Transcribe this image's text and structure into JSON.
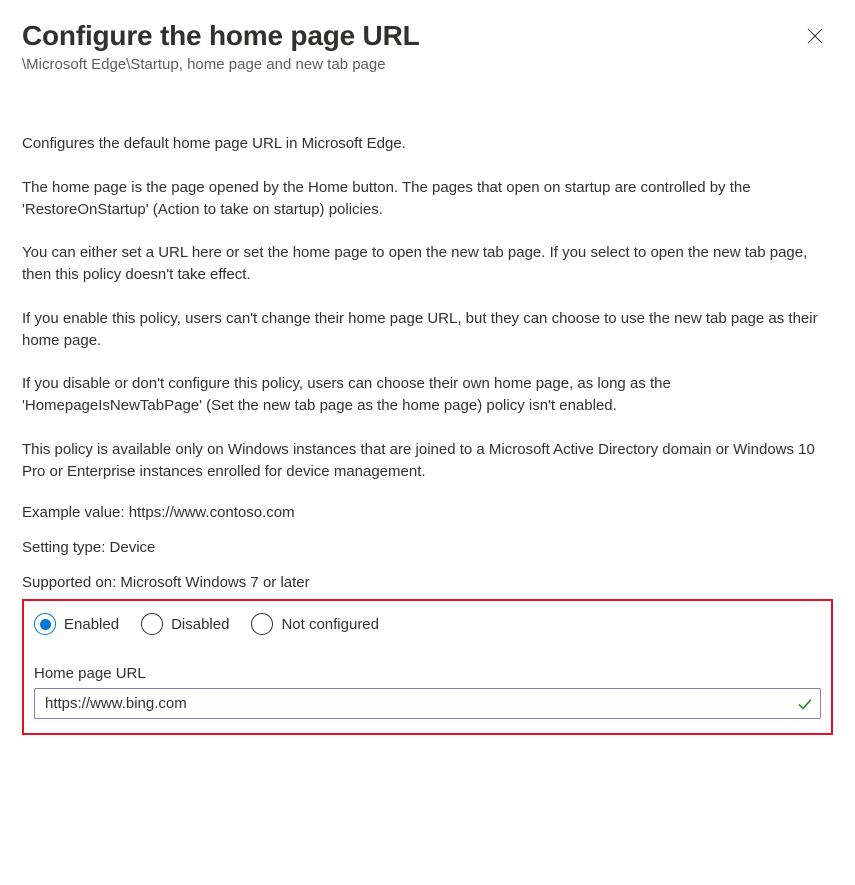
{
  "header": {
    "title": "Configure the home page URL",
    "breadcrumb": "\\Microsoft Edge\\Startup, home page and new tab page"
  },
  "description": {
    "p1": "Configures the default home page URL in Microsoft Edge.",
    "p2": "The home page is the page opened by the Home button. The pages that open on startup are controlled by the 'RestoreOnStartup' (Action to take on startup) policies.",
    "p3": "You can either set a URL here or set the home page to open the new tab page. If you select to open the new tab page, then this policy doesn't take effect.",
    "p4": "If you enable this policy, users can't change their home page URL, but they can choose to use the new tab page as their home page.",
    "p5": "If you disable or don't configure this policy, users can choose their own home page, as long as the 'HomepageIsNewTabPage' (Set the new tab page as the home page) policy isn't enabled.",
    "p6": "This policy is available only on Windows instances that are joined to a Microsoft Active Directory domain or Windows 10 Pro or Enterprise instances enrolled for device management."
  },
  "meta": {
    "example": "Example value: https://www.contoso.com",
    "setting_type": "Setting type: Device",
    "supported_on": "Supported on: Microsoft Windows 7 or later"
  },
  "options": {
    "enabled": "Enabled",
    "disabled": "Disabled",
    "not_configured": "Not configured",
    "selected": "enabled"
  },
  "field": {
    "label": "Home page URL",
    "value": "https://www.bing.com"
  }
}
